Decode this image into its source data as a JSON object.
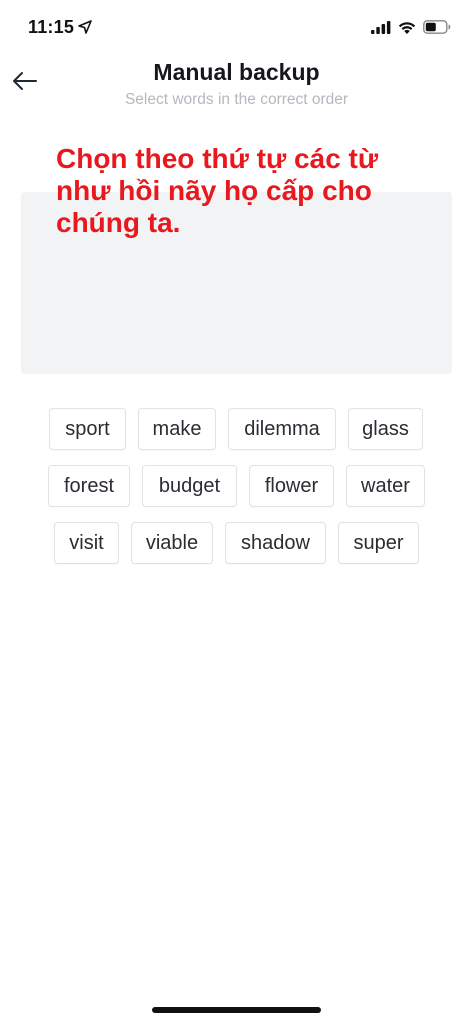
{
  "status_bar": {
    "time": "11:15",
    "icons": [
      "location-arrow-icon",
      "cellular-signal-icon",
      "wifi-icon",
      "battery-icon"
    ]
  },
  "header": {
    "back_icon": "arrow-left-icon",
    "title": "Manual backup",
    "subtitle": "Select words in the correct order"
  },
  "annotation": {
    "text": "Chọn theo thứ tự các từ như hồi nãy họ cấp cho chúng ta.",
    "color": "#e8191e"
  },
  "words": {
    "row1": [
      "sport",
      "make",
      "dilemma",
      "glass"
    ],
    "row2": [
      "forest",
      "budget",
      "flower",
      "water"
    ],
    "row3": [
      "visit",
      "viable",
      "shadow",
      "super"
    ]
  },
  "colors": {
    "title": "#15171c",
    "subtitle": "#b4b8bf",
    "drop_area": "#f2f3f5",
    "chip_border": "#dfe2e6"
  }
}
